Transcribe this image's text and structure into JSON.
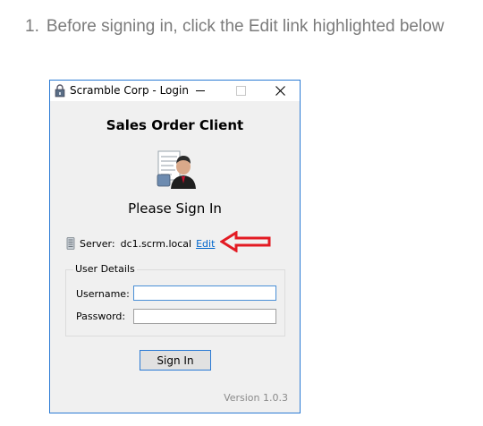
{
  "instruction": {
    "number": "1.",
    "text": "Before signing in, click the Edit link highlighted below"
  },
  "window": {
    "title": "Scramble Corp - Login",
    "app_title": "Sales Order Client",
    "heading": "Please Sign In",
    "server": {
      "label": "Server:",
      "value": "dc1.scrm.local",
      "edit_link": "Edit"
    },
    "user_details": {
      "legend": "User Details",
      "username_label": "Username:",
      "username_value": "",
      "password_label": "Password:",
      "password_value": ""
    },
    "signin_button": "Sign In",
    "version": "Version 1.0.3"
  },
  "colors": {
    "accent": "#2a7ad4",
    "link": "#0066cc",
    "highlight_arrow": "#e31b23"
  },
  "icons": [
    "app-lock-icon",
    "minimize-icon",
    "maximize-icon",
    "close-icon",
    "user-document-icon",
    "server-icon",
    "red-arrow-icon"
  ]
}
